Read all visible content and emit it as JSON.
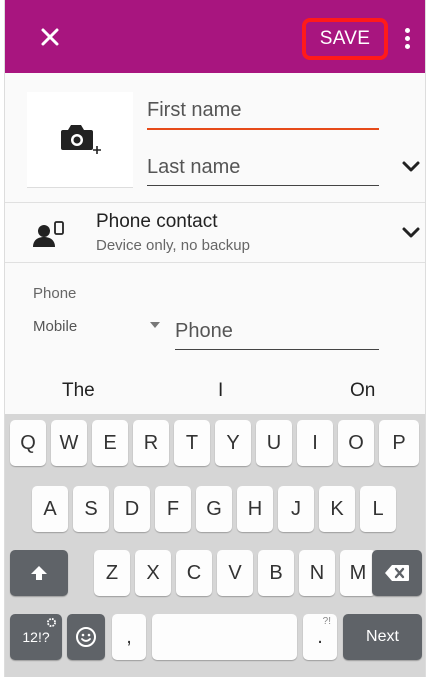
{
  "appbar": {
    "close_icon": "close-icon",
    "save_label": "SAVE",
    "overflow_icon": "more-vert-icon",
    "color": "#a8157f"
  },
  "name": {
    "camera_icon": "add-photo-icon",
    "first_name_placeholder": "First name",
    "last_name_placeholder": "Last name",
    "accent_color": "#e64a19"
  },
  "account": {
    "icon": "phone-contact-icon",
    "title": "Phone contact",
    "subtitle": "Device only, no backup"
  },
  "phone": {
    "section_label": "Phone",
    "type_value": "Mobile",
    "placeholder": "Phone"
  },
  "suggestions": [
    "The",
    "I",
    "On"
  ],
  "keyboard": {
    "row1": [
      "Q",
      "W",
      "E",
      "R",
      "T",
      "Y",
      "U",
      "I",
      "O",
      "P"
    ],
    "row2": [
      "A",
      "S",
      "D",
      "F",
      "G",
      "H",
      "J",
      "K",
      "L"
    ],
    "row3": [
      "Z",
      "X",
      "C",
      "V",
      "B",
      "N",
      "M"
    ],
    "symbols_label": "12!?",
    "comma_label": ",",
    "period_label": ".",
    "period_sub": "?!",
    "next_label": "Next"
  }
}
